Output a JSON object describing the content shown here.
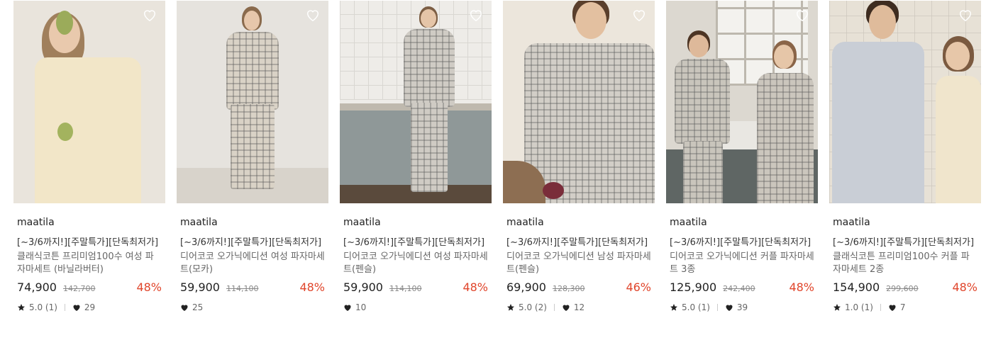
{
  "products": [
    {
      "brand": "maatila",
      "promo": "[~3/6까지!][주말특가][단독최저가]",
      "name": "클래식코튼 프리미엄100수 여성 파자마세트 (바닐라버터)",
      "price": "74,900",
      "original_price": "142,700",
      "discount": "48%",
      "rating": "5.0 (1)",
      "likes": "29",
      "has_rating": true,
      "image": "woman-with-grapes"
    },
    {
      "brand": "maatila",
      "promo": "[~3/6까지!][주말특가][단독최저가]",
      "name": "디어코코 오가닉에디션 여성 파자마세트(모카)",
      "price": "59,900",
      "original_price": "114,100",
      "discount": "48%",
      "rating": "",
      "likes": "25",
      "has_rating": false,
      "image": "woman-standing-studio"
    },
    {
      "brand": "maatila",
      "promo": "[~3/6까지!][주말특가][단독최저가]",
      "name": "디어코코 오가닉에디션 여성 파자마세트(펜슬)",
      "price": "59,900",
      "original_price": "114,100",
      "discount": "48%",
      "rating": "",
      "likes": "10",
      "has_rating": false,
      "image": "woman-kitchen"
    },
    {
      "brand": "maatila",
      "promo": "[~3/6까지!][주말특가][단독최저가]",
      "name": "디어코코 오가닉에디션 남성 파자마세트(펜슬)",
      "price": "69,900",
      "original_price": "128,300",
      "discount": "46%",
      "rating": "5.0 (2)",
      "likes": "12",
      "has_rating": true,
      "image": "man-cooking"
    },
    {
      "brand": "maatila",
      "promo": "[~3/6까지!][주말특가][단독최저가]",
      "name": "디어코코 오가닉에디션 커플 파자마세트 3종",
      "price": "125,900",
      "original_price": "242,400",
      "discount": "48%",
      "rating": "5.0 (1)",
      "likes": "39",
      "has_rating": true,
      "image": "couple-bathroom"
    },
    {
      "brand": "maatila",
      "promo": "[~3/6까지!][주말특가][단독최저가]",
      "name": "클래식코튼 프리미엄100수 커플 파자마세트 2종",
      "price": "154,900",
      "original_price": "299,600",
      "discount": "48%",
      "rating": "1.0 (1)",
      "likes": "7",
      "has_rating": true,
      "image": "couple-phone"
    }
  ],
  "icons": {
    "wishlist": "heart-outline-icon",
    "rating": "star-icon",
    "likes": "heart-filled-icon"
  },
  "colors": {
    "discount": "#e0452b",
    "text": "#222222",
    "muted": "#888888"
  }
}
